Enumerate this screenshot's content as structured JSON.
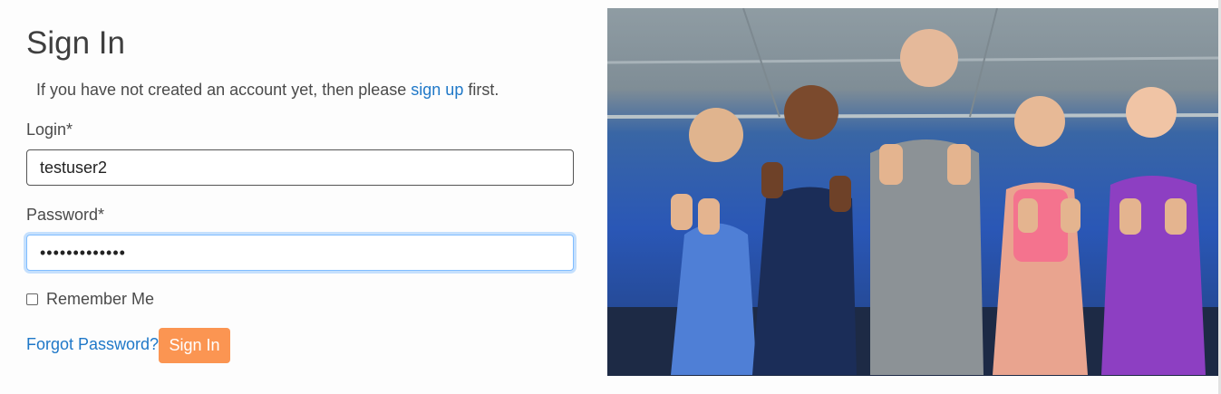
{
  "page": {
    "title": "Sign In",
    "intro_before": "If you have not created an account yet, then please ",
    "intro_link": "sign up",
    "intro_after": " first."
  },
  "form": {
    "login_label": "Login*",
    "login_value": "testuser2",
    "password_label": "Password*",
    "password_value": "•••••••••••••",
    "remember_label": "Remember Me",
    "remember_checked": false,
    "forgot_link": "Forgot Password?",
    "submit_label": "Sign In"
  },
  "hero": {
    "image": "group-of-five-people-giving-thumbs-up-in-gym"
  },
  "colors": {
    "accent_button": "#fb9552",
    "link": "#1f78c8",
    "focus_ring": "#80bdff"
  }
}
